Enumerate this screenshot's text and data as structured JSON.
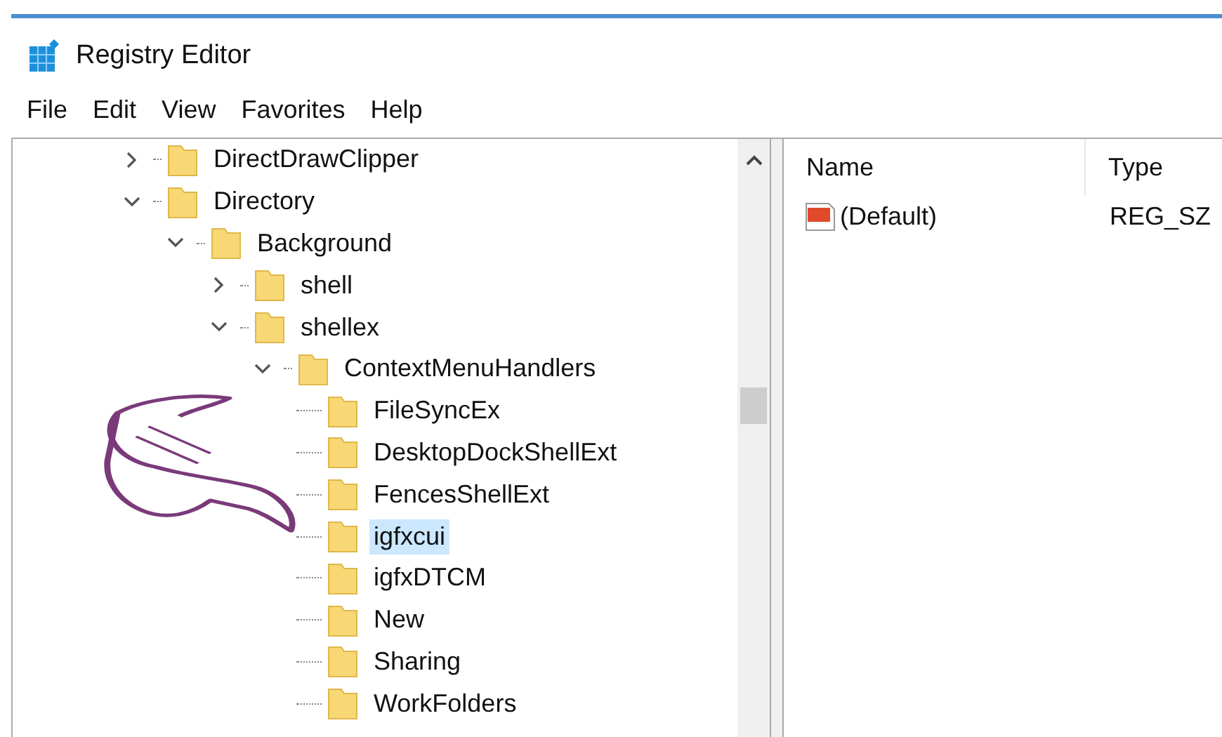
{
  "window": {
    "title": "Registry Editor"
  },
  "menu": [
    "File",
    "Edit",
    "View",
    "Favorites",
    "Help"
  ],
  "tree": [
    {
      "label": "DirectDrawClipper",
      "kind": "branch",
      "expanded": false,
      "selected": false
    },
    {
      "label": "Directory",
      "kind": "branch",
      "expanded": true,
      "selected": false,
      "children": [
        {
          "label": "Background",
          "kind": "branch",
          "expanded": true,
          "selected": false,
          "children": [
            {
              "label": "shell",
              "kind": "branch",
              "expanded": false,
              "selected": false
            },
            {
              "label": "shellex",
              "kind": "branch",
              "expanded": true,
              "selected": false,
              "children": [
                {
                  "label": "ContextMenuHandlers",
                  "kind": "branch",
                  "expanded": true,
                  "selected": false,
                  "children": [
                    {
                      "label": "FileSyncEx",
                      "kind": "leaf",
                      "selected": false
                    },
                    {
                      "label": "DesktopDockShellExt",
                      "kind": "leaf",
                      "selected": false
                    },
                    {
                      "label": "FencesShellExt",
                      "kind": "leaf",
                      "selected": false
                    },
                    {
                      "label": "igfxcui",
                      "kind": "leaf",
                      "selected": true
                    },
                    {
                      "label": "igfxDTCM",
                      "kind": "leaf",
                      "selected": false
                    },
                    {
                      "label": "New",
                      "kind": "leaf",
                      "selected": false
                    },
                    {
                      "label": "Sharing",
                      "kind": "leaf",
                      "selected": false
                    },
                    {
                      "label": "WorkFolders",
                      "kind": "leaf",
                      "selected": false
                    }
                  ]
                }
              ]
            }
          ]
        }
      ]
    }
  ],
  "values": {
    "columns": [
      "Name",
      "Type"
    ],
    "rows": [
      {
        "name": "(Default)",
        "type": "REG_SZ"
      }
    ]
  }
}
